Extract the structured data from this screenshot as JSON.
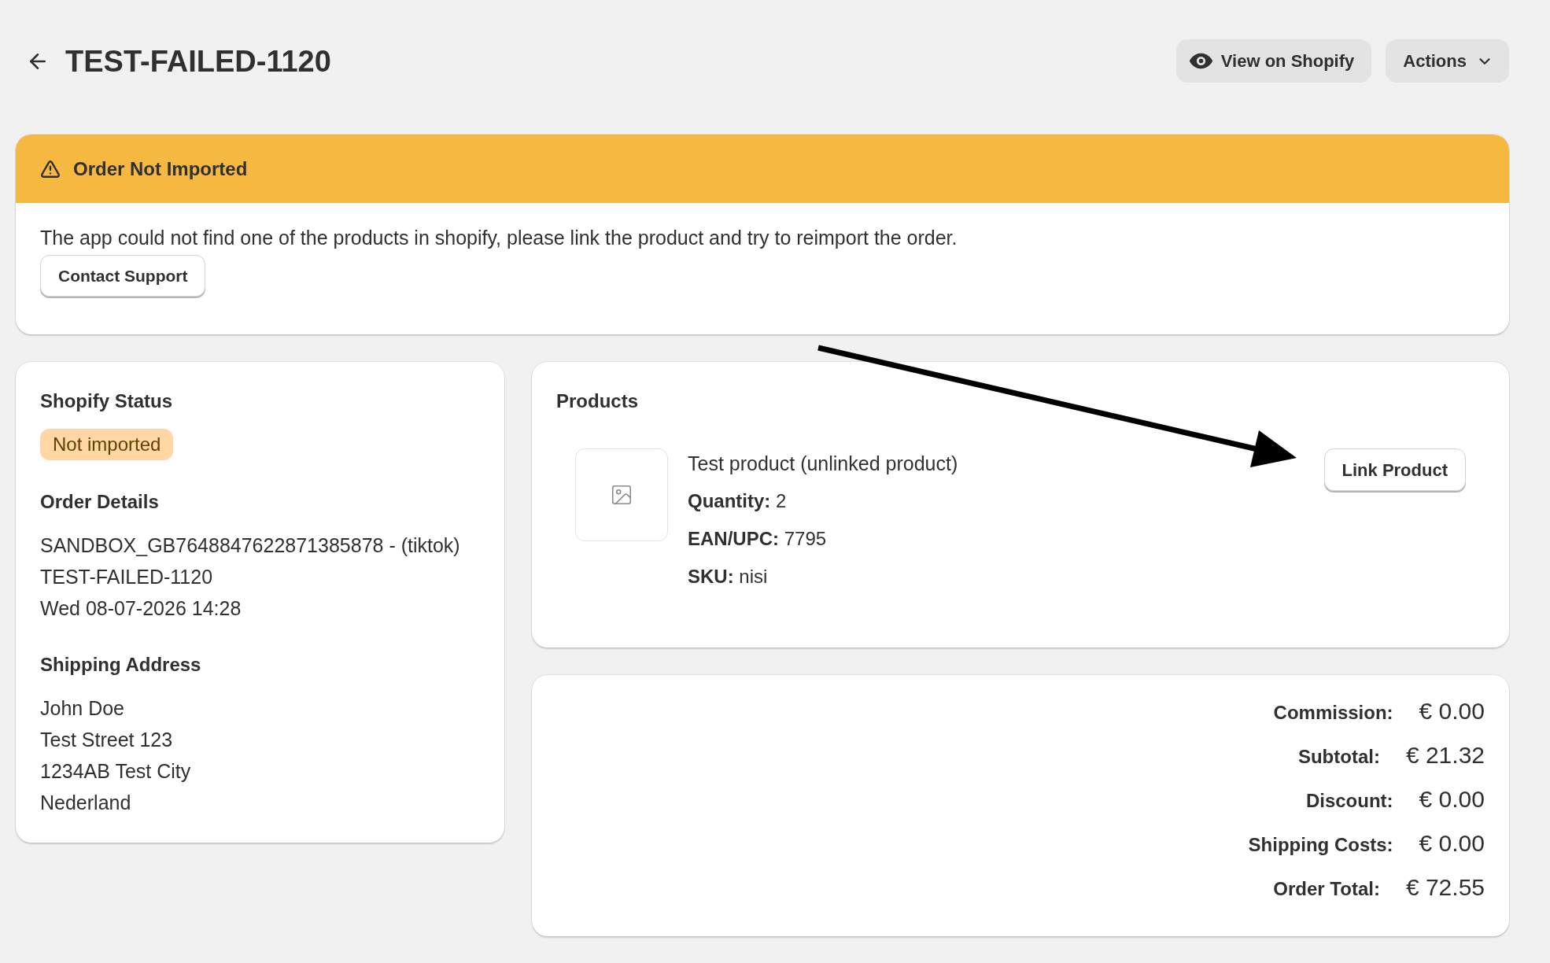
{
  "header": {
    "title": "TEST-FAILED-1120",
    "buttons": [
      {
        "label": "View on Shopify",
        "kind": "view"
      },
      {
        "label": "Actions",
        "kind": "menu"
      }
    ]
  },
  "alert": {
    "title": "Order Not Imported",
    "message": "The app could not find one of the products in shopify, please link the product and try to reimport the order.",
    "button": "Contact Support"
  },
  "shopify_status": {
    "title": "Shopify Status",
    "badge": "Not imported"
  },
  "order_details": {
    "title": "Order Details",
    "lines": [
      "SANDBOX_GB7648847622871385878 - (tiktok)",
      "TEST-FAILED-1120",
      "Wed 08-07-2026 14:28"
    ]
  },
  "shipping_address": {
    "title": "Shipping Address",
    "lines": [
      "John Doe",
      "Test Street 123",
      "1234AB Test City",
      "Nederland"
    ]
  },
  "products": {
    "title": "Products",
    "items": [
      {
        "name": "Test product (unlinked product)",
        "fields": [
          {
            "label": "Quantity:",
            "value": "2"
          },
          {
            "label": "EAN/UPC:",
            "value": "7795"
          },
          {
            "label": "SKU:",
            "value": "nisi"
          }
        ],
        "button": "Link Product"
      }
    ]
  },
  "totals": [
    {
      "label": "Commission:",
      "value": "€ 0.00"
    },
    {
      "label": "Subtotal:",
      "value": "€ 21.32"
    },
    {
      "label": "Discount:",
      "value": "€ 0.00"
    },
    {
      "label": "Shipping Costs:",
      "value": "€ 0.00"
    },
    {
      "label": "Order Total:",
      "value": "€ 72.55"
    }
  ]
}
